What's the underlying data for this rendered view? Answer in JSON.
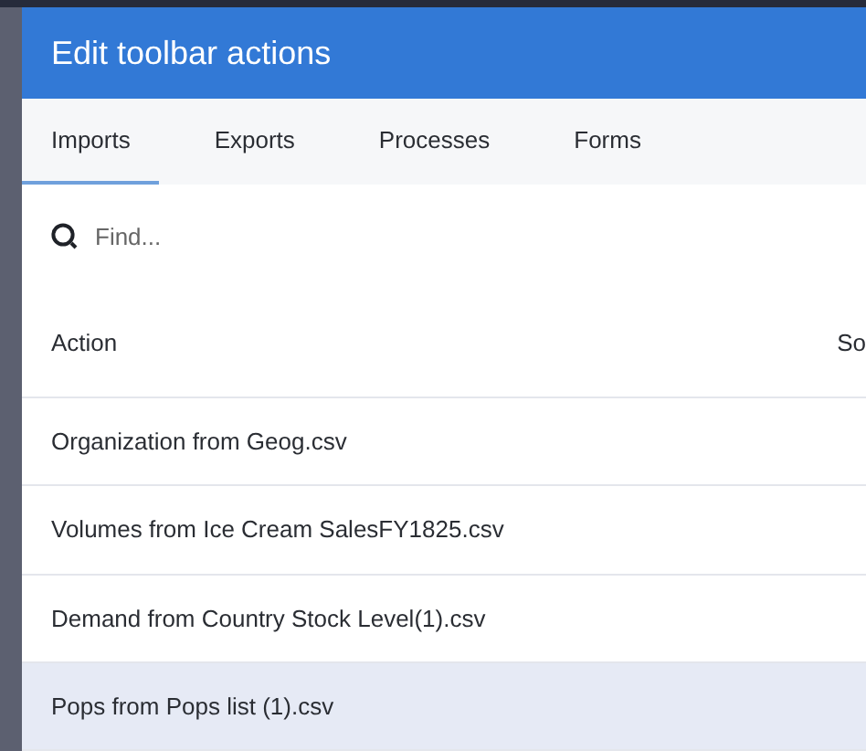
{
  "window": {
    "title": "Edit toolbar actions"
  },
  "tabs": [
    {
      "label": "Imports",
      "selected": true
    },
    {
      "label": "Exports",
      "selected": false
    },
    {
      "label": "Processes",
      "selected": false
    },
    {
      "label": "Forms",
      "selected": false
    }
  ],
  "search": {
    "placeholder": "Find..."
  },
  "table": {
    "columns": [
      "Action",
      "So"
    ],
    "rows": [
      {
        "action": "Organization from Geog.csv",
        "selected": false
      },
      {
        "action": "Volumes from Ice Cream SalesFY1825.csv",
        "selected": false
      },
      {
        "action": "Demand from Country Stock Level(1).csv",
        "selected": false
      },
      {
        "action": "Pops from Pops list (1).csv",
        "selected": true
      }
    ]
  }
}
